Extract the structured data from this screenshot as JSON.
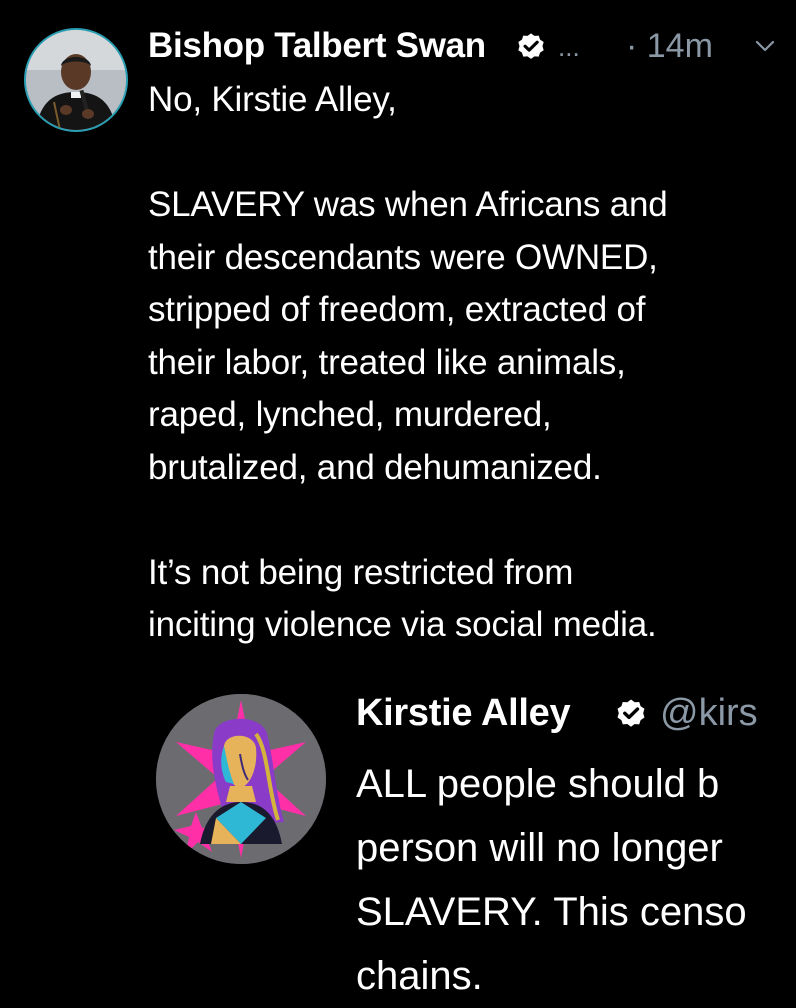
{
  "tweet": {
    "author_name": "Bishop Talbert Swan",
    "truncation": "...",
    "time": "· 14m",
    "paragraphs": [
      [
        "No, Kirstie Alley,"
      ],
      [
        "SLAVERY was when Africans and",
        "their descendants were OWNED,",
        "stripped of freedom, extracted of",
        "their labor, treated like animals,",
        "raped, lynched, murdered,",
        "brutalized, and dehumanized."
      ],
      [
        "It’s not being restricted from",
        "inciting violence via social media."
      ]
    ]
  },
  "quote": {
    "author_name": "Kirstie Alley",
    "handle": "@kirs",
    "lines": [
      "ALL people should b",
      "person will no longer",
      "SLAVERY. This censo",
      "chains."
    ]
  },
  "icons": {
    "verified": "verified-badge-icon",
    "more": "chevron-down-icon"
  },
  "colors": {
    "background": "#000000",
    "text_primary": "#ffffff",
    "text_secondary": "#8b98a5",
    "avatar_ring": "#2a9fb3"
  }
}
